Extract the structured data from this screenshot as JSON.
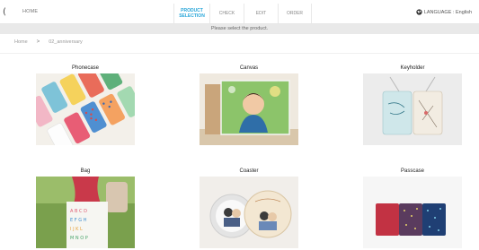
{
  "nav": {
    "back_glyph": "(",
    "home_label": "HOME",
    "tabs": [
      {
        "label": "PRODUCT SELECTION",
        "active": true
      },
      {
        "label": "CHECK",
        "active": false
      },
      {
        "label": "EDIT",
        "active": false
      },
      {
        "label": "ORDER",
        "active": false
      }
    ],
    "language_label": "LANGUAGE : English"
  },
  "notice": "Please select the product.",
  "breadcrumb": {
    "home": "Home",
    "separator": ">",
    "current": "02_anniversary"
  },
  "products": [
    {
      "name": "Phonecase"
    },
    {
      "name": "Canvas"
    },
    {
      "name": "Keyholder"
    },
    {
      "name": "Bag"
    },
    {
      "name": "Coaster"
    },
    {
      "name": "Passcase"
    }
  ],
  "colors": {
    "accent": "#29a6d9",
    "notice_bg": "#e9e9e9"
  },
  "icons": [
    "globe-icon"
  ]
}
